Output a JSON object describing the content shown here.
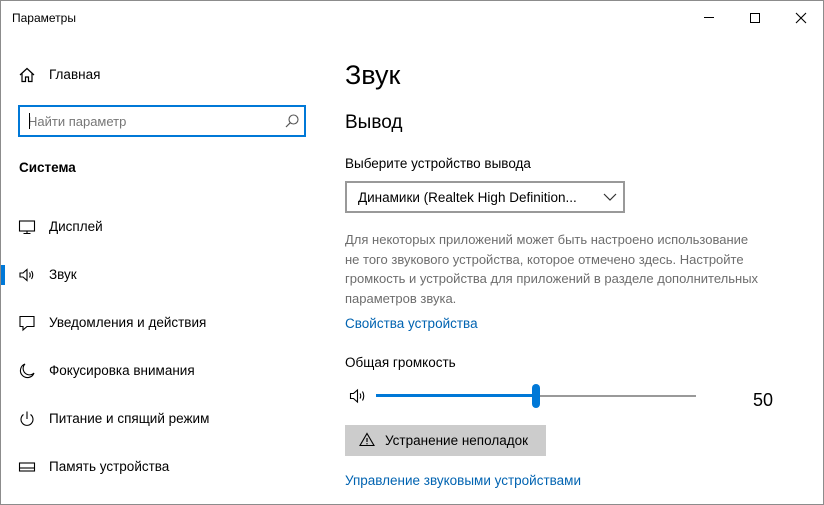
{
  "window": {
    "title": "Параметры"
  },
  "sidebar": {
    "home_label": "Главная",
    "search_placeholder": "Найти параметр",
    "section_title": "Система",
    "items": [
      {
        "label": "Дисплей",
        "icon": "monitor-icon",
        "selected": false
      },
      {
        "label": "Звук",
        "icon": "speaker-icon",
        "selected": true
      },
      {
        "label": "Уведомления и действия",
        "icon": "notification-icon",
        "selected": false
      },
      {
        "label": "Фокусировка внимания",
        "icon": "moon-icon",
        "selected": false
      },
      {
        "label": "Питание и спящий режим",
        "icon": "power-icon",
        "selected": false
      },
      {
        "label": "Память устройства",
        "icon": "storage-icon",
        "selected": false
      }
    ]
  },
  "main": {
    "title": "Звук",
    "output": {
      "heading": "Вывод",
      "device_label": "Выберите устройство вывода",
      "device_selected": "Динамики (Realtek High Definition...",
      "info_lines": [
        "Для некоторых приложений может быть настроено использование",
        "не того звукового устройства, которое отмечено здесь. Настройте",
        "громкость и устройства для приложений в разделе дополнительных",
        "параметров звука."
      ],
      "properties_link": "Свойства устройства",
      "volume_label": "Общая громкость",
      "volume_value": "50",
      "volume_fraction": 0.5,
      "troubleshoot_label": "Устранение неполадок",
      "manage_link": "Управление звуковыми устройствами"
    }
  },
  "colors": {
    "accent": "#0078d7",
    "link": "#0063b1",
    "info_text": "#6d6d6d",
    "button_bg": "#cccccc"
  }
}
